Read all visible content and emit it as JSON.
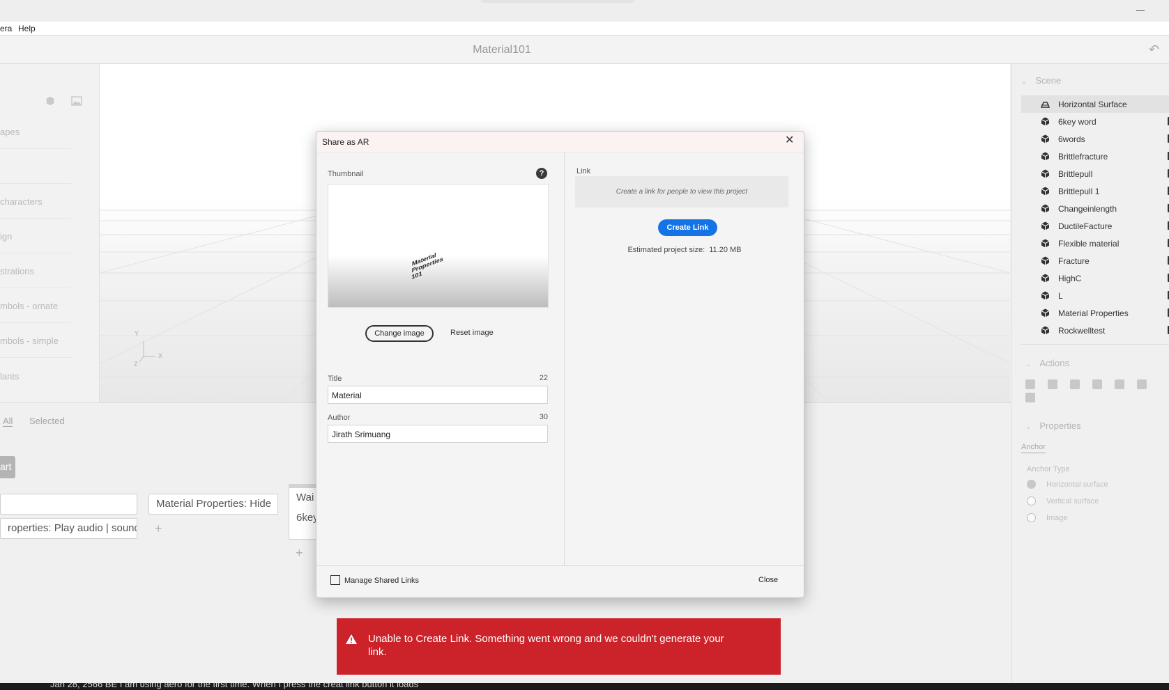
{
  "menubar": {
    "items": [
      "era",
      "Help"
    ]
  },
  "document": {
    "title": "Material101"
  },
  "left_panel": {
    "items": [
      "apes",
      "characters",
      "ign",
      "strations",
      "mbols - ornate",
      "mbols - simple",
      "lants"
    ]
  },
  "viewport": {
    "axis": {
      "y": "Y",
      "x": "X",
      "z": "Z"
    }
  },
  "scene": {
    "header": "Scene",
    "items": [
      "Horizontal Surface",
      "6key word",
      "6words",
      "Brittlefracture",
      "Brittlepull",
      "Brittlepull 1",
      "Changeinlength",
      "DuctileFacture",
      "Flexible material",
      "Fracture",
      "HighC",
      "L",
      "Material Properties",
      "Rockwelltest"
    ]
  },
  "actions": {
    "header": "Actions"
  },
  "properties": {
    "header": "Properties",
    "tab": "Anchor",
    "anchor_type_label": "Anchor Type",
    "options": [
      "Horizontal surface",
      "Vertical surface",
      "Image"
    ],
    "selected": "Horizontal surface"
  },
  "bottom": {
    "tabs": [
      "All",
      "Selected"
    ],
    "start_label": "art",
    "nodes": [
      "Material Properties: Hide",
      "roperties: Play audio | sound",
      "Wai",
      "6key"
    ]
  },
  "dialog": {
    "title": "Share as AR",
    "thumbnail_label": "Thumbnail",
    "thumbnail_text": [
      "Material",
      "Properties",
      "101"
    ],
    "change_image": "Change image",
    "reset_image": "Reset image",
    "title_label": "Title",
    "title_count": "22",
    "title_value": "Material",
    "author_label": "Author",
    "author_count": "30",
    "author_value": "Jirath Srimuang",
    "link_label": "Link",
    "link_placeholder": "Create a link for people to view this project",
    "create_link": "Create Link",
    "estimated_size_label": "Estimated project size:",
    "estimated_size_value": "11.20 MB",
    "manage_links": "Manage Shared Links",
    "close": "Close"
  },
  "toast": {
    "message": "Unable to Create Link. Something went wrong and we couldn't generate your link.",
    "color": "#cc2229"
  },
  "taskbar": {
    "text": "Jan 28, 2566 BE     I am using aero for the first time. When I press the creat link button it loads"
  },
  "colors": {
    "accent": "#1473e6",
    "error": "#cc2229"
  }
}
